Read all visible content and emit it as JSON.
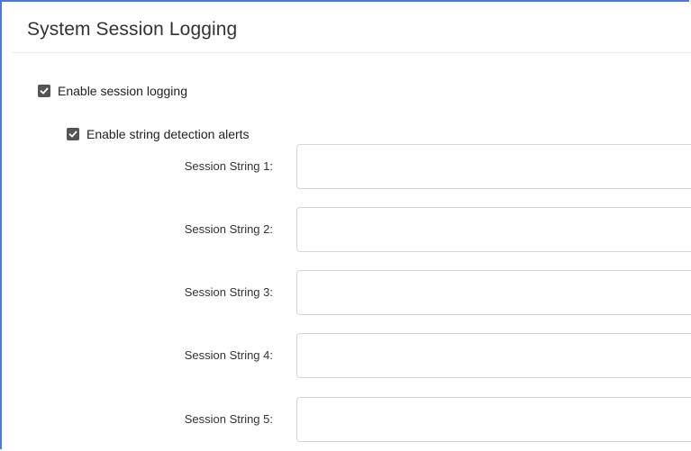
{
  "panel": {
    "title": "System Session Logging"
  },
  "options": {
    "enable_logging": {
      "label": "Enable session logging",
      "checked": true
    },
    "enable_alerts": {
      "label": "Enable string detection alerts",
      "checked": true
    }
  },
  "session_strings": [
    {
      "label": "Session String 1:",
      "value": ""
    },
    {
      "label": "Session String 2:",
      "value": ""
    },
    {
      "label": "Session String 3:",
      "value": ""
    },
    {
      "label": "Session String 4:",
      "value": ""
    },
    {
      "label": "Session String 5:",
      "value": ""
    }
  ]
}
